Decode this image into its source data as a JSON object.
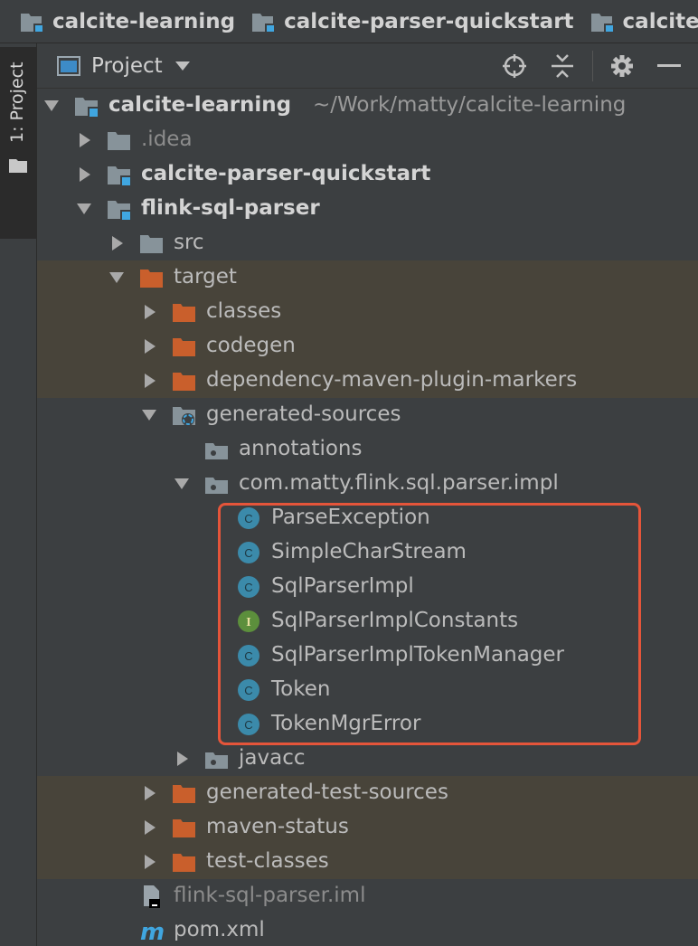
{
  "breadcrumb": [
    {
      "label": "calcite-learning"
    },
    {
      "label": "calcite-parser-quickstart"
    },
    {
      "label": "calcite-"
    }
  ],
  "toolstrip": {
    "project_tab": "1: Project"
  },
  "header": {
    "title": "Project"
  },
  "tree": [
    {
      "label": "calcite-learning",
      "path": "~/Work/matty/calcite-learning",
      "style": "bold",
      "icon": "module-folder-icon",
      "arrow": "expanded"
    },
    {
      "label": ".idea",
      "style": "gray",
      "icon": "folder-icon",
      "arrow": "collapsed"
    },
    {
      "label": "calcite-parser-quickstart",
      "style": "bold",
      "icon": "module-folder-icon",
      "arrow": "collapsed"
    },
    {
      "label": "flink-sql-parser",
      "style": "bold",
      "icon": "module-folder-icon",
      "arrow": "expanded"
    },
    {
      "label": "src",
      "style": "normal",
      "icon": "folder-icon",
      "arrow": "collapsed"
    },
    {
      "label": "target",
      "style": "normal",
      "icon": "excluded-folder-icon",
      "arrow": "expanded",
      "highlight": true
    },
    {
      "label": "classes",
      "style": "normal",
      "icon": "excluded-folder-icon",
      "arrow": "collapsed",
      "highlight": true
    },
    {
      "label": "codegen",
      "style": "normal",
      "icon": "excluded-folder-icon",
      "arrow": "collapsed",
      "highlight": true
    },
    {
      "label": "dependency-maven-plugin-markers",
      "style": "normal",
      "icon": "excluded-folder-icon",
      "arrow": "collapsed",
      "highlight": true
    },
    {
      "label": "generated-sources",
      "style": "normal",
      "icon": "generated-sources-folder-icon",
      "arrow": "expanded"
    },
    {
      "label": "annotations",
      "style": "normal",
      "icon": "package-icon",
      "arrow": "none"
    },
    {
      "label": "com.matty.flink.sql.parser.impl",
      "style": "normal",
      "icon": "package-icon",
      "arrow": "expanded"
    },
    {
      "label": "ParseException",
      "style": "normal",
      "icon": "class-icon",
      "arrow": "none"
    },
    {
      "label": "SimpleCharStream",
      "style": "normal",
      "icon": "class-icon",
      "arrow": "none"
    },
    {
      "label": "SqlParserImpl",
      "style": "normal",
      "icon": "class-icon",
      "arrow": "none"
    },
    {
      "label": "SqlParserImplConstants",
      "style": "normal",
      "icon": "interface-icon",
      "arrow": "none"
    },
    {
      "label": "SqlParserImplTokenManager",
      "style": "normal",
      "icon": "class-icon",
      "arrow": "none"
    },
    {
      "label": "Token",
      "style": "normal",
      "icon": "class-icon",
      "arrow": "none"
    },
    {
      "label": "TokenMgrError",
      "style": "normal",
      "icon": "class-icon",
      "arrow": "none"
    },
    {
      "label": "javacc",
      "style": "normal",
      "icon": "package-icon",
      "arrow": "collapsed"
    },
    {
      "label": "generated-test-sources",
      "style": "normal",
      "icon": "excluded-folder-icon",
      "arrow": "collapsed",
      "highlight": true
    },
    {
      "label": "maven-status",
      "style": "normal",
      "icon": "excluded-folder-icon",
      "arrow": "collapsed",
      "highlight": true
    },
    {
      "label": "test-classes",
      "style": "normal",
      "icon": "excluded-folder-icon",
      "arrow": "collapsed",
      "highlight": true
    },
    {
      "label": "flink-sql-parser.iml",
      "style": "gray",
      "icon": "iml-file-icon",
      "arrow": "none"
    },
    {
      "label": "pom.xml",
      "style": "normal",
      "icon": "maven-icon",
      "arrow": "none"
    }
  ],
  "icons": {
    "class_letter": "C",
    "interface_letter": "I",
    "maven_letter": "m"
  },
  "colors": {
    "class": "#3b8aaa",
    "interface": "#5c8f3c",
    "excluded": "#c95f2c",
    "folder": "#87939a",
    "module_dot": "#40a6e0",
    "selection_border": "#e5553a",
    "highlight_row": "#48443a"
  }
}
